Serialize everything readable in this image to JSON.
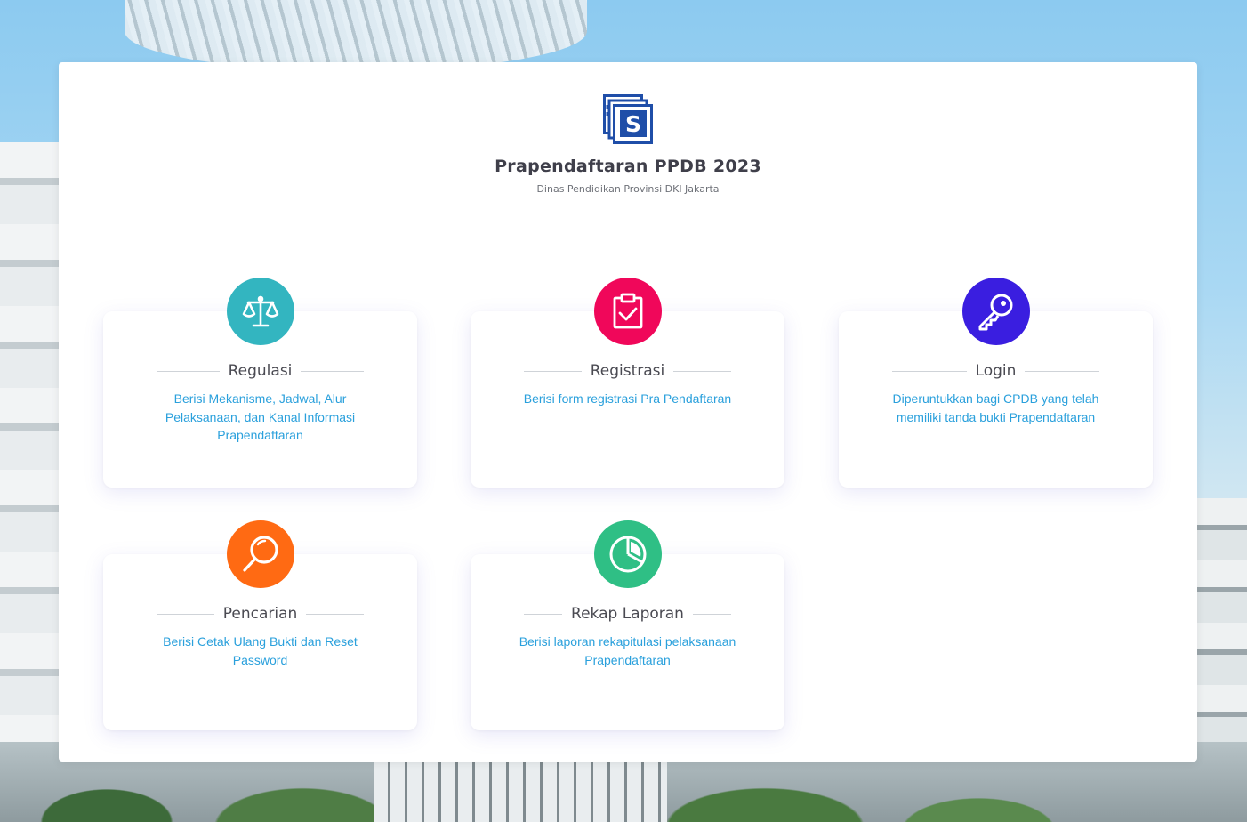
{
  "header": {
    "title": "Prapendaftaran PPDB 2023",
    "subtitle": "Dinas Pendidikan Provinsi DKI Jakarta",
    "logo_icon": "ppdb-logo-s-icon"
  },
  "colors": {
    "regulasi": "#33b5c0",
    "registrasi": "#f0075a",
    "login": "#3a1ee0",
    "pencarian": "#ff6a13",
    "rekap": "#2fbf85",
    "link_text": "#2aa0dc"
  },
  "cards": [
    {
      "title": "Regulasi",
      "description": "Berisi Mekanisme, Jadwal, Alur Pelaksanaan, dan Kanal Informasi Prapendaftaran",
      "icon": "scale-balance-icon"
    },
    {
      "title": "Registrasi",
      "description": "Berisi form registrasi Pra Pendaftaran",
      "icon": "clipboard-check-icon"
    },
    {
      "title": "Login",
      "description": "Diperuntukkan bagi CPDB yang telah memiliki tanda bukti Prapendaftaran",
      "icon": "key-icon"
    },
    {
      "title": "Pencarian",
      "description": "Berisi Cetak Ulang Bukti dan Reset Password",
      "icon": "search-icon"
    },
    {
      "title": "Rekap Laporan",
      "description": "Berisi laporan rekapitulasi pelaksanaan Prapendaftaran",
      "icon": "pie-chart-icon"
    }
  ]
}
